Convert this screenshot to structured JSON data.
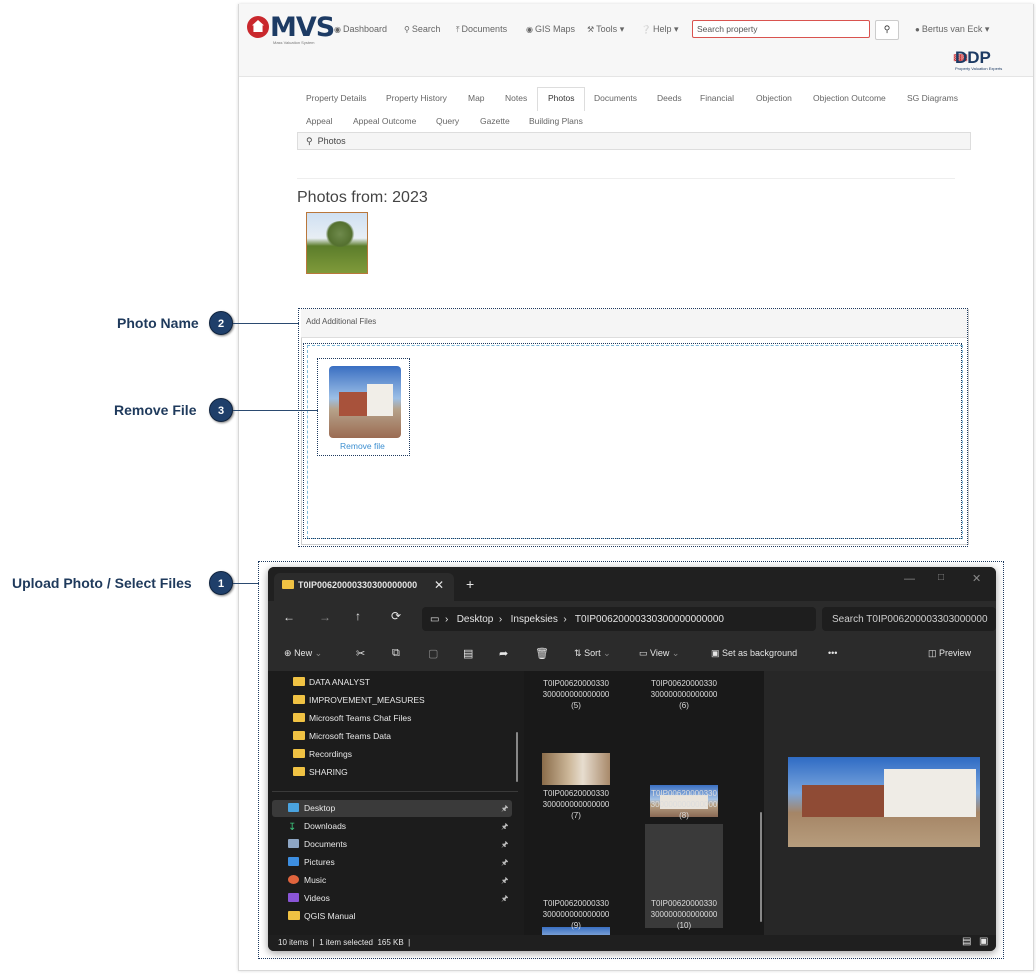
{
  "app": {
    "logo_text": "MVS",
    "logo_sub": "Mass Valuation System",
    "nav": {
      "dashboard": "Dashboard",
      "search": "Search",
      "documents": "Documents",
      "gis_maps": "GIS Maps",
      "tools": "Tools",
      "help": "Help",
      "user": "Bertus van Eck"
    },
    "search_placeholder": "Search property",
    "ddp_logo": "DDP",
    "ddp_sub": "Property Valuation Experts",
    "tabs_row1": [
      "Property Details",
      "Property History",
      "Map",
      "Notes",
      "Photos",
      "Documents",
      "Deeds",
      "Financial",
      "Objection",
      "Objection Outcome",
      "SG Diagrams"
    ],
    "tabs_row2": [
      "Appeal",
      "Appeal Outcome",
      "Query",
      "Gazette",
      "Building Plans"
    ],
    "active_tab": "Photos",
    "breadcrumb": "Photos",
    "photos_title": "Photos from: 2023",
    "dropzone_title": "Add Additional Files",
    "remove_file": "Remove file"
  },
  "callouts": {
    "c1": {
      "number": "1",
      "label": "Upload Photo / Select Files"
    },
    "c2": {
      "number": "2",
      "label": "Photo Name"
    },
    "c3": {
      "number": "3",
      "label": "Remove File"
    }
  },
  "explorer": {
    "tab_title": "T0IP00620000330300000000",
    "path": [
      "Desktop",
      "Inspeksies",
      "T0IP00620000330300000000000"
    ],
    "search_placeholder": "Search T0IP006200003303000000",
    "commands": {
      "new": "New",
      "sort": "Sort",
      "view": "View",
      "set_background": "Set as background",
      "more": "•••",
      "preview": "Preview"
    },
    "sidebar_top": [
      "DATA ANALYST",
      "IMPROVEMENT_MEASURES",
      "Microsoft Teams Chat Files",
      "Microsoft Teams Data",
      "Recordings",
      "SHARING"
    ],
    "sidebar_quick": [
      "Desktop",
      "Downloads",
      "Documents",
      "Pictures",
      "Music",
      "Videos",
      "QGIS Manual"
    ],
    "files": [
      {
        "line1": "T0IP00620000330",
        "line2": "300000000000000",
        "line3": "(5)"
      },
      {
        "line1": "T0IP00620000330",
        "line2": "300000000000000",
        "line3": "(6)"
      },
      {
        "line1": "T0IP00620000330",
        "line2": "300000000000000",
        "line3": "(7)"
      },
      {
        "line1": "T0IP00620000330",
        "line2": "300000000000000",
        "line3": "(8)"
      },
      {
        "line1": "T0IP00620000330",
        "line2": "300000000000000",
        "line3": "(9)"
      },
      {
        "line1": "T0IP00620000330",
        "line2": "300000000000000",
        "line3": "(10)"
      }
    ],
    "status": {
      "items": "10 items",
      "selected": "1 item selected",
      "size": "165 KB"
    }
  }
}
